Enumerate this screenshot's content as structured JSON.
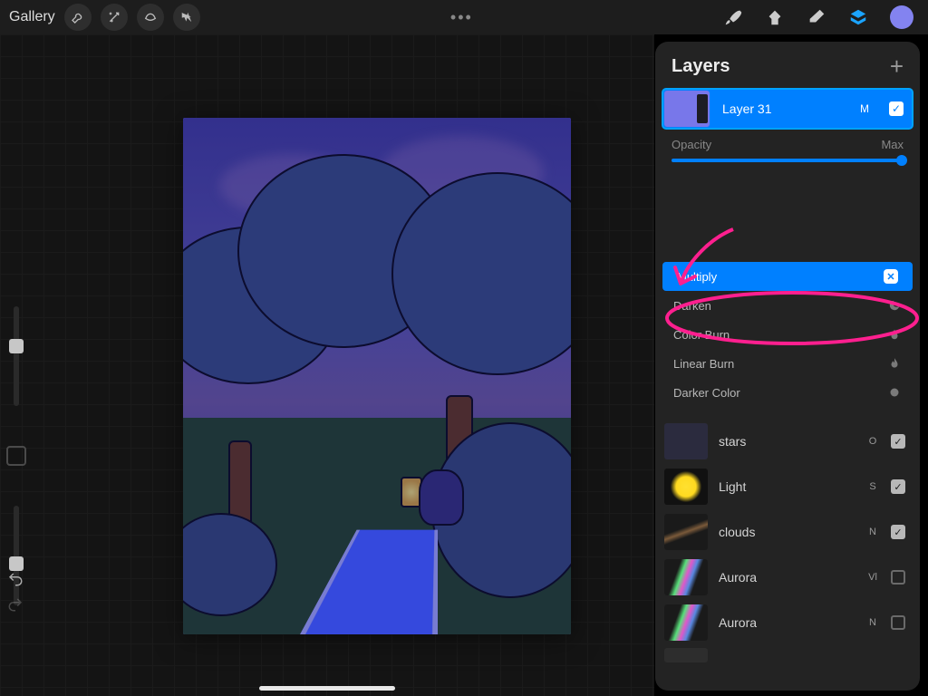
{
  "topbar": {
    "gallery": "Gallery",
    "more": "•••"
  },
  "colors": {
    "accent": "#0080ff",
    "annotation": "#ff1f8f",
    "layer31_fill": "#7877ea"
  },
  "panel": {
    "title": "Layers",
    "active_layer": {
      "name": "Layer 31",
      "blend_short": "M"
    },
    "opacity": {
      "label": "Opacity",
      "value_label": "Max",
      "value": 100
    },
    "blend_modes": [
      {
        "name": "Multiply",
        "selected": true
      },
      {
        "name": "Darken",
        "selected": false
      },
      {
        "name": "Color Burn",
        "selected": false
      },
      {
        "name": "Linear Burn",
        "selected": false
      },
      {
        "name": "Darker Color",
        "selected": false
      }
    ],
    "layers": [
      {
        "name": "stars",
        "mode": "O",
        "visible": true,
        "thumb": "th-stars"
      },
      {
        "name": "Light",
        "mode": "S",
        "visible": true,
        "thumb": "th-light"
      },
      {
        "name": "clouds",
        "mode": "N",
        "visible": true,
        "thumb": "th-clouds"
      },
      {
        "name": "Aurora",
        "mode": "Vl",
        "visible": false,
        "thumb": "th-aurora"
      },
      {
        "name": "Aurora",
        "mode": "N",
        "visible": false,
        "thumb": "th-aurora"
      }
    ]
  }
}
